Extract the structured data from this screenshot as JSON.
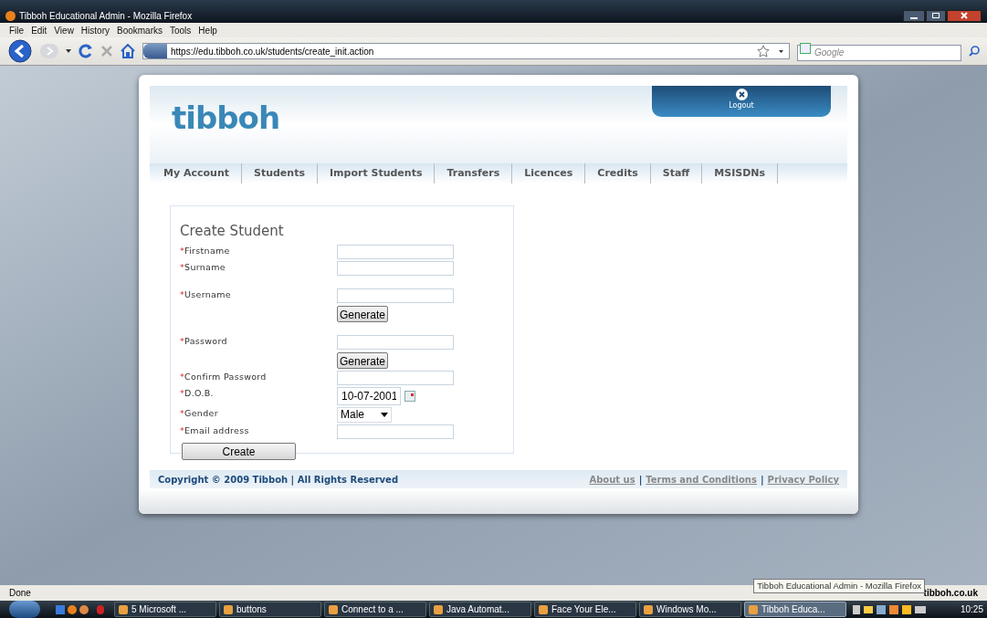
{
  "window": {
    "title": "Tibboh Educational Admin - Mozilla Firefox"
  },
  "menu": [
    "File",
    "Edit",
    "View",
    "History",
    "Bookmarks",
    "Tools",
    "Help"
  ],
  "address": {
    "url": "https://edu.tibboh.co.uk/students/create_init.action"
  },
  "search": {
    "placeholder": "Google"
  },
  "site": {
    "logo": "tibboh",
    "logout": "Logout",
    "nav": [
      {
        "label": "My Account"
      },
      {
        "label": "Students"
      },
      {
        "label": "Import Students"
      },
      {
        "label": "Transfers"
      },
      {
        "label": "Licences"
      },
      {
        "label": "Credits"
      },
      {
        "label": "Staff"
      },
      {
        "label": "MSISDNs"
      }
    ],
    "form": {
      "title": "Create Student",
      "fields": [
        {
          "mark": "*",
          "label": "Firstname",
          "kind": "text"
        },
        {
          "mark": "*",
          "label": "Surname",
          "kind": "text"
        },
        {
          "mark": "*",
          "label": "Username",
          "kind": "text",
          "button": "Generate"
        },
        {
          "mark": "*",
          "label": "Password",
          "kind": "text",
          "button": "Generate"
        },
        {
          "mark": "*",
          "label": "Confirm Password",
          "kind": "text"
        },
        {
          "mark": "*",
          "label": "D.O.B.",
          "kind": "date",
          "value": "10-07-2001"
        },
        {
          "mark": "*",
          "label": "Gender",
          "kind": "select",
          "value": "Male"
        },
        {
          "mark": "*",
          "label": "Email address",
          "kind": "text"
        }
      ],
      "submit": "Create"
    },
    "footer": {
      "copyright": "Copyright © 2009 Tibboh | All Rights Reserved",
      "links": [
        "About us",
        "Terms and Conditions",
        "Privacy Policy"
      ],
      "separator": "|"
    }
  },
  "status_bar": {
    "text": "Done",
    "url": "tibboh.co.uk",
    "tooltip": "Tibboh Educational Admin - Mozilla Firefox"
  },
  "taskbar": {
    "items": [
      {
        "label": "5 Microsoft ...",
        "selected": false
      },
      {
        "label": "buttons",
        "selected": false
      },
      {
        "label": "Connect to a ...",
        "selected": false
      },
      {
        "label": "Java Automat...",
        "selected": false
      },
      {
        "label": "Face Your Ele...",
        "selected": false
      },
      {
        "label": "Windows Mo...",
        "selected": false
      },
      {
        "label": "Tibboh Educa...",
        "selected": true
      }
    ],
    "clock": "10:25"
  }
}
